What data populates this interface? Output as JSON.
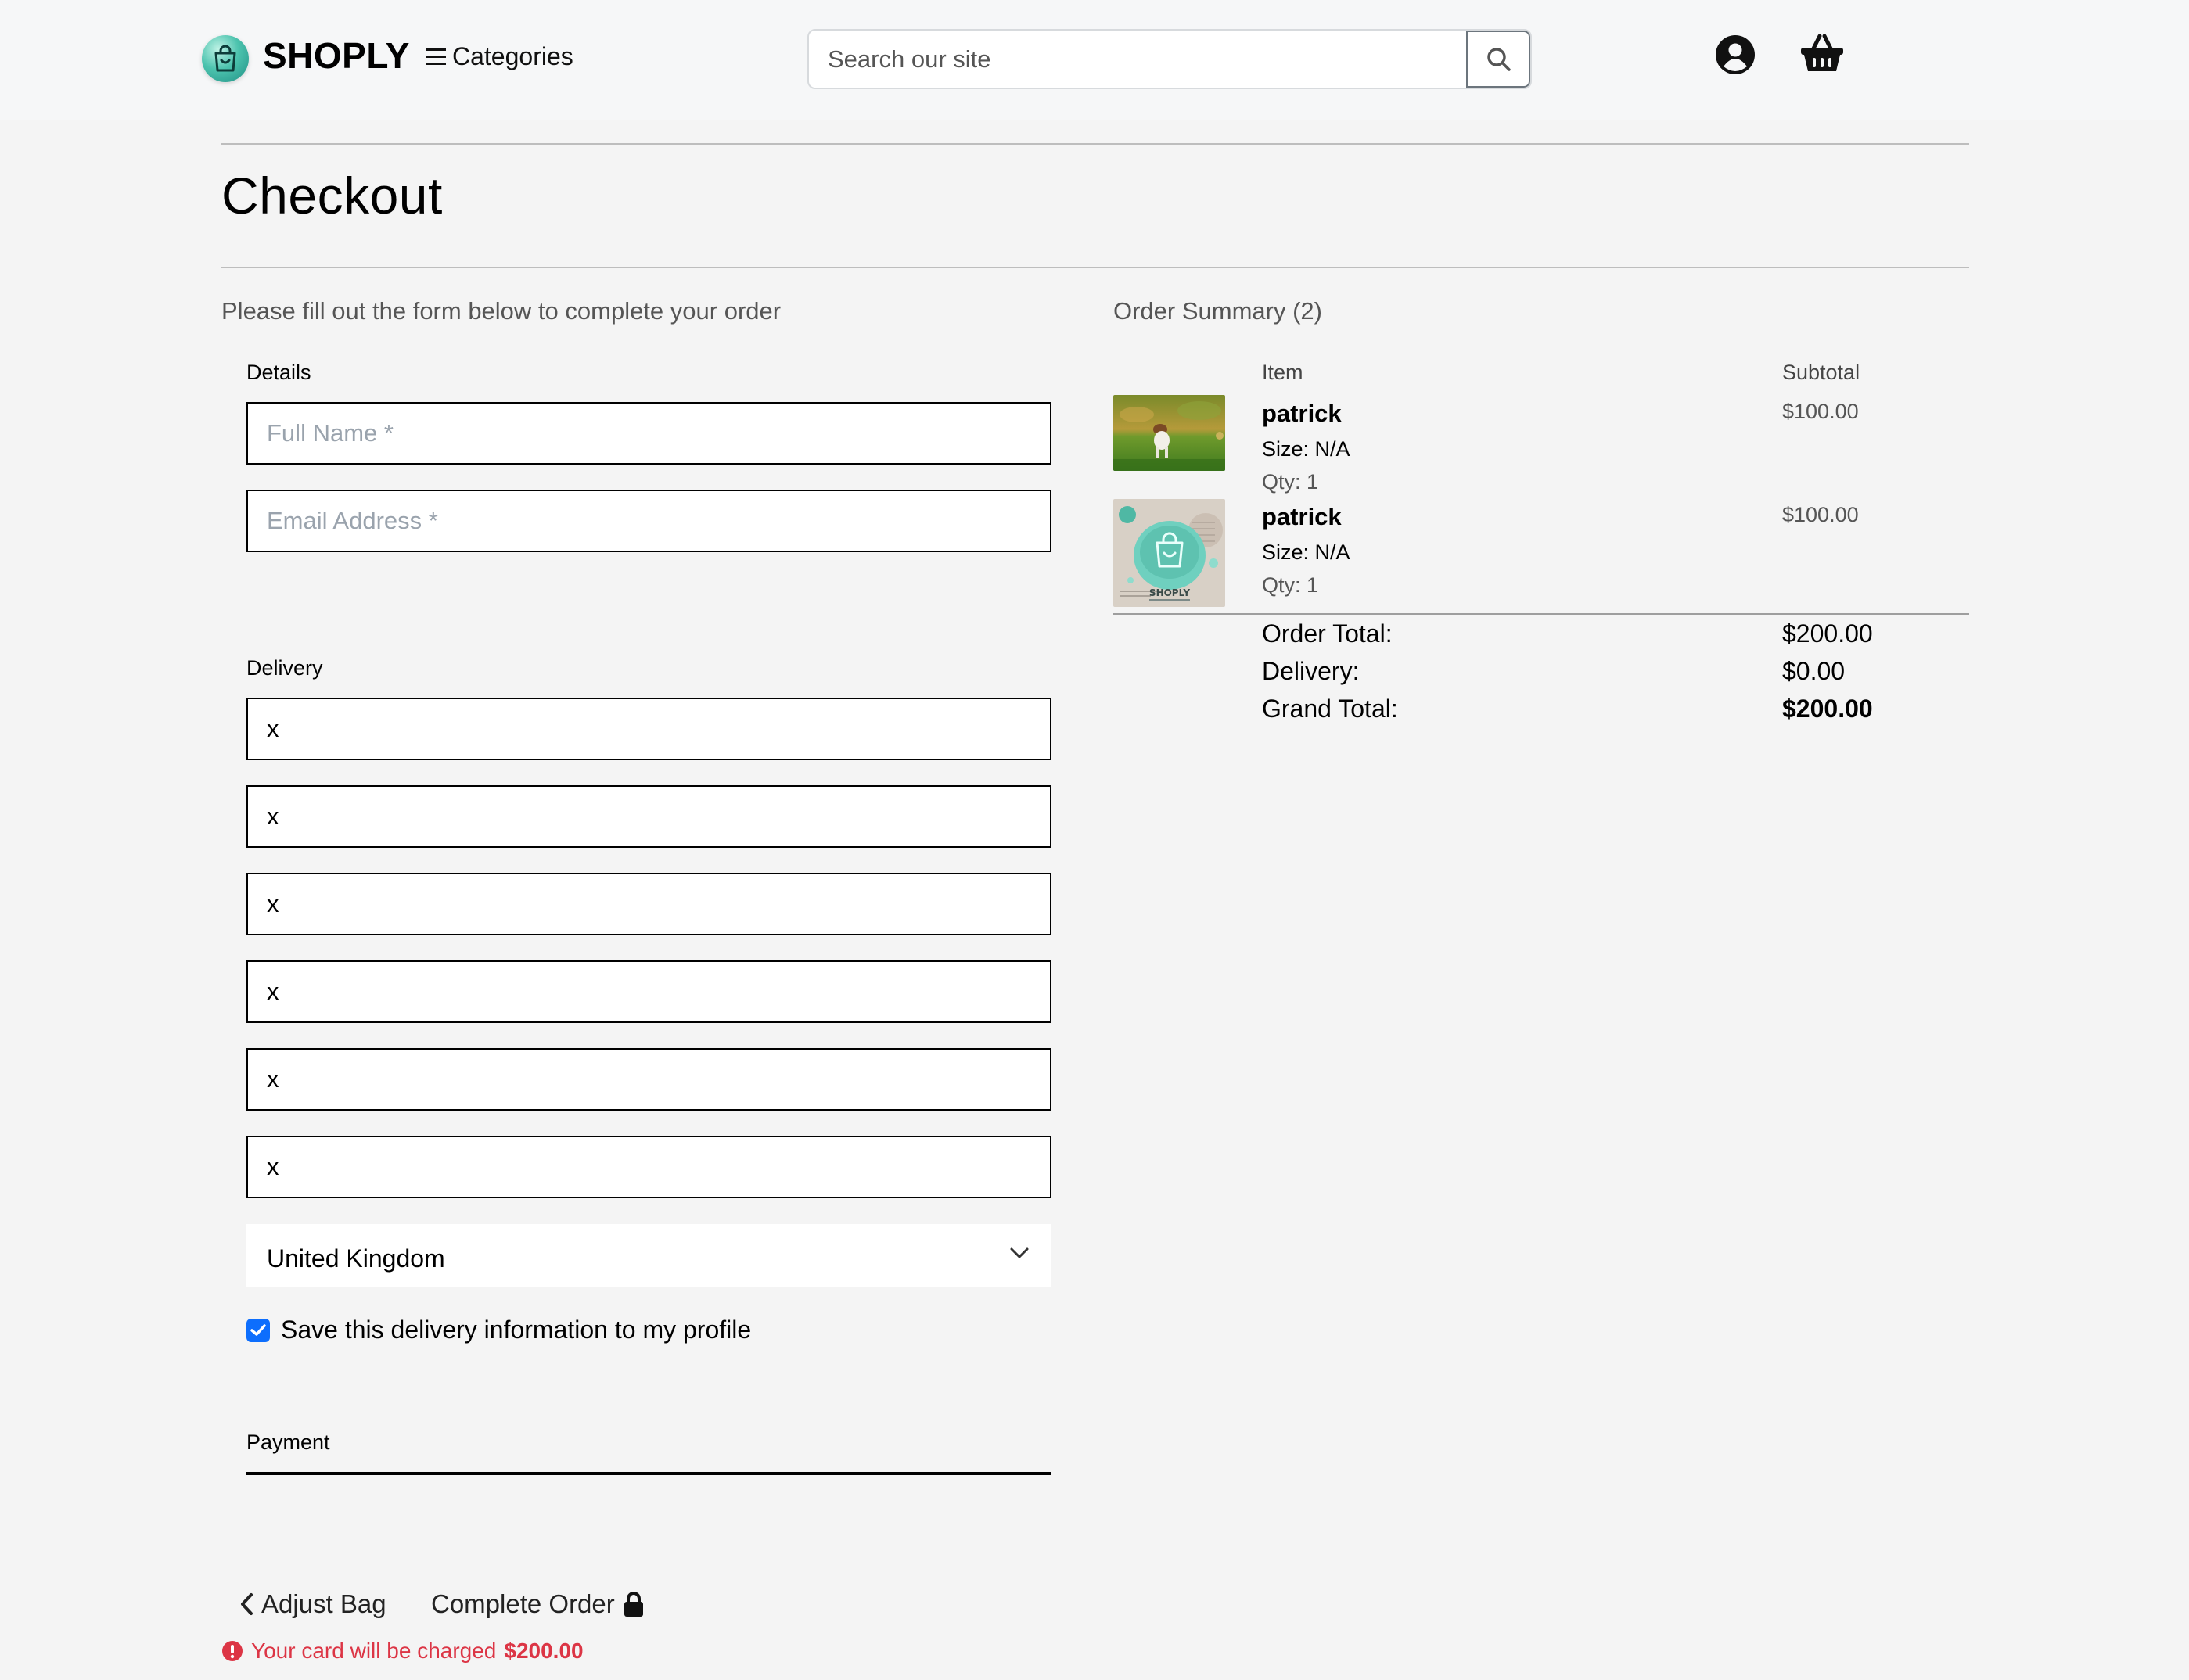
{
  "header": {
    "brand": "SHOPLY",
    "categories_label": "Categories",
    "search_placeholder": "Search our site"
  },
  "page": {
    "title": "Checkout",
    "intro": "Please fill out the form below to complete your order"
  },
  "form": {
    "details_label": "Details",
    "full_name_placeholder": "Full Name *",
    "email_placeholder": "Email Address *",
    "delivery_label": "Delivery",
    "delivery_fields": [
      "x",
      "x",
      "x",
      "x",
      "x",
      "x"
    ],
    "country": "United Kingdom",
    "save_delivery_label": "Save this delivery information to my profile",
    "save_delivery_checked": true,
    "payment_label": "Payment"
  },
  "actions": {
    "adjust_bag": "Adjust Bag",
    "complete_order": "Complete Order",
    "charge_note_prefix": "Your card will be charged",
    "charge_amount": "$200.00"
  },
  "summary": {
    "heading": "Order Summary (2)",
    "col_item": "Item",
    "col_subtotal": "Subtotal",
    "items": [
      {
        "name": "patrick",
        "size": "Size: N/A",
        "qty": "Qty: 1",
        "subtotal": "$100.00",
        "image": "dog-on-grass"
      },
      {
        "name": "patrick",
        "size": "Size: N/A",
        "qty": "Qty: 1",
        "subtotal": "$100.00",
        "image": "shoply-logo-card"
      }
    ],
    "order_total_label": "Order Total:",
    "order_total": "$200.00",
    "delivery_label": "Delivery:",
    "delivery": "$0.00",
    "grand_total_label": "Grand Total:",
    "grand_total": "$200.00"
  },
  "colors": {
    "accent": "#0d6efd",
    "error": "#dc3545",
    "brand_teal": "#4cc3ae"
  }
}
